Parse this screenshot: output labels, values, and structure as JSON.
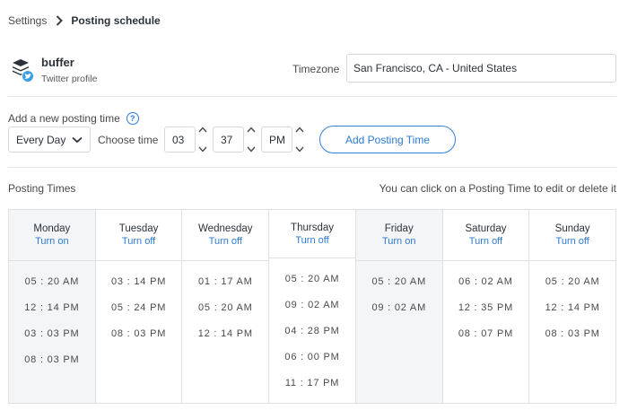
{
  "breadcrumb": {
    "root": "Settings",
    "current": "Posting schedule"
  },
  "profile": {
    "name": "buffer",
    "type": "Twitter profile"
  },
  "timezone": {
    "label": "Timezone",
    "value": "San Francisco, CA - United States"
  },
  "add_time": {
    "label": "Add a new posting time",
    "day_select": "Every Day",
    "choose_label": "Choose time",
    "hour": "03",
    "minute": "37",
    "ampm": "PM",
    "button": "Add Posting Time"
  },
  "posting_times": {
    "label": "Posting Times",
    "hint": "You can click on a Posting Time to edit or delete it"
  },
  "colors": {
    "accent": "#2c7ad3",
    "twitter": "#3ca0e6",
    "off_column_bg": "#f4f5f6"
  },
  "days": [
    {
      "name": "Monday",
      "toggle": "Turn on",
      "times": [
        "05 : 20  AM",
        "12 : 14  PM",
        "03 : 03  PM",
        "08 : 03  PM"
      ]
    },
    {
      "name": "Tuesday",
      "toggle": "Turn off",
      "times": [
        "03 : 14  PM",
        "05 : 24  PM",
        "08 : 03  PM"
      ]
    },
    {
      "name": "Wednesday",
      "toggle": "Turn off",
      "times": [
        "01 : 17  AM",
        "05 : 20  AM",
        "12 : 14  PM"
      ]
    },
    {
      "name": "Thursday",
      "toggle": "Turn off",
      "times": [
        "05 : 20  AM",
        "09 : 02  AM",
        "04 : 28  PM",
        "06 : 00  PM",
        "11 : 17  PM"
      ]
    },
    {
      "name": "Friday",
      "toggle": "Turn on",
      "times": [
        "05 : 20  AM",
        "09 : 02  AM"
      ]
    },
    {
      "name": "Saturday",
      "toggle": "Turn off",
      "times": [
        "06 : 02  AM",
        "12 : 35  PM",
        "08 : 07  PM"
      ]
    },
    {
      "name": "Sunday",
      "toggle": "Turn off",
      "times": [
        "05 : 20  AM",
        "12 : 14  PM",
        "08 : 03  PM"
      ]
    }
  ]
}
